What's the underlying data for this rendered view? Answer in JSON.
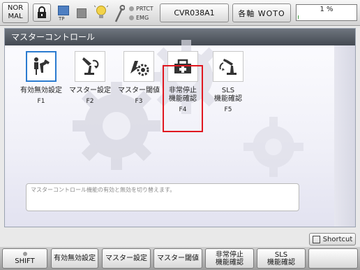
{
  "topbar": {
    "mode_line1": "NOR",
    "mode_line2": "MAL",
    "tp_label": "TP",
    "prtct_label": "PRTCT",
    "emg_label": "EMG",
    "program_name": "CVR038A1",
    "axis_label": "各軸 WOTO",
    "override_text": "1 %",
    "override_value": 1
  },
  "panel": {
    "title": "マスターコントロール",
    "items": [
      {
        "label": "有効無効設定",
        "label2": "",
        "key": "F1",
        "icon": "enable-toggle-icon"
      },
      {
        "label": "マスター設定",
        "label2": "",
        "key": "F2",
        "icon": "robot-arm-icon"
      },
      {
        "label": "マスター閾値",
        "label2": "",
        "key": "F3",
        "icon": "motor-gear-icon"
      },
      {
        "label": "非常停止",
        "label2": "機能確認",
        "key": "F4",
        "icon": "emergency-icon"
      },
      {
        "label": "SLS",
        "label2": "機能確認",
        "key": "F5",
        "icon": "sls-robot-icon"
      }
    ],
    "message": "マスターコントロール機能の有効と無効を切り替えます。"
  },
  "shortcut": {
    "label": "Shortcut"
  },
  "fkeys": [
    {
      "line1": "SHIFT",
      "line2": ""
    },
    {
      "line1": "有効無効設定",
      "line2": ""
    },
    {
      "line1": "マスター設定",
      "line2": ""
    },
    {
      "line1": "マスター閾値",
      "line2": ""
    },
    {
      "line1": "非常停止",
      "line2": "機能確認"
    },
    {
      "line1": "SLS",
      "line2": "機能確認"
    },
    {
      "line1": "",
      "line2": ""
    }
  ],
  "colors": {
    "selection": "#2b7bd0",
    "highlight": "#e0171f",
    "title_bar": "#50565e"
  }
}
